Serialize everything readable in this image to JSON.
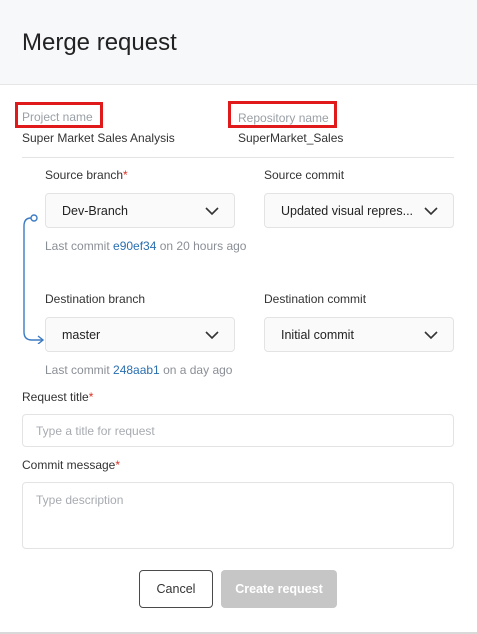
{
  "dialog": {
    "title": "Merge request"
  },
  "project": {
    "label": "Project name",
    "value": "Super Market Sales Analysis"
  },
  "repository": {
    "label": "Repository name",
    "value": "SuperMarket_Sales"
  },
  "source": {
    "branch_label": "Source branch",
    "branch_value": "Dev-Branch",
    "commit_label": "Source commit",
    "commit_value": "Updated visual repres...",
    "last_commit_prefix": "Last commit ",
    "last_commit_hash": "e90ef34",
    "last_commit_suffix": " on 20 hours ago"
  },
  "destination": {
    "branch_label": "Destination branch",
    "branch_value": "master",
    "commit_label": "Destination commit",
    "commit_value": "Initial commit",
    "last_commit_prefix": "Last commit ",
    "last_commit_hash": "248aab1",
    "last_commit_suffix": " on a day ago"
  },
  "required_marker": "*",
  "request_title": {
    "label": "Request title",
    "placeholder": "Type a title for request",
    "value": ""
  },
  "commit_message": {
    "label": "Commit message",
    "placeholder": "Type description",
    "value": ""
  },
  "actions": {
    "cancel_label": "Cancel",
    "create_label": "Create request"
  },
  "colors": {
    "highlight_box": "#e01a1a",
    "link": "#2a6fb0",
    "connector": "#3b7bc4",
    "disabled_button": "#c6c6c6"
  },
  "icons": {
    "dropdown": "chevron-down-icon"
  }
}
